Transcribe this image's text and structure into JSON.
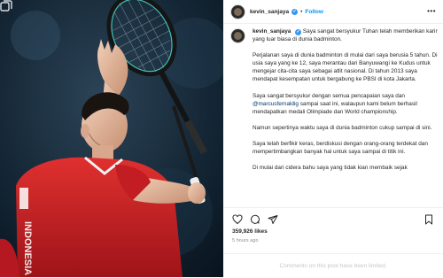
{
  "post": {
    "username": "kevin_sanjaya",
    "follow_label": "Follow",
    "caption": {
      "intro": "Saya sangat bersyukur Tuhan telah memberikan karir yang luar biasa di dunia badminton.",
      "p1": "Perjalanan saya di dunia badminton di mulai dari saya berusia 5 tahun. Di usia saya yang ke 12, saya merantau dari Banyuwangi ke Kudus untuk mengejar cita-cita saya sebagai atlit nasional. Di tahun 2013 saya mendapat kesempatan untuk bergabung ke PBSI di kota Jakarta.",
      "p2_before": "Saya sangat bersyukur dengan semua pencapaian saya dan ",
      "p2_mention": "@marcusfernaldig",
      "p2_after": " sampai saat ini, walaupun kami belum berhasil mendapatkan medali Olimpiade dan World championship.",
      "p3": "Namun sepertinya waktu saya di dunia badminton cukup sampai di sini.",
      "p4": "Saya telah berfikir keras, berdiskusi dengan orang-orang terdekat dan mempertimbangkan banyak hal untuk saya sampai di titik ini.",
      "p5": "Di mulai dari cidera bahu saya yang tidak kian membaik sejak"
    },
    "likes": "359,926 likes",
    "time_ago": "5 hours ago",
    "comments_notice": "Comments on this post have been limited."
  },
  "icons": {
    "more": "more-options-icon",
    "like": "heart-icon",
    "comment": "comment-icon",
    "share": "share-icon",
    "save": "bookmark-icon",
    "carousel": "carousel-icon"
  },
  "colors": {
    "accent": "#0095f6",
    "verified": "#3897f0",
    "mention": "#00376b",
    "muted": "#8e8e8e",
    "jersey_red": "#d8262c"
  }
}
